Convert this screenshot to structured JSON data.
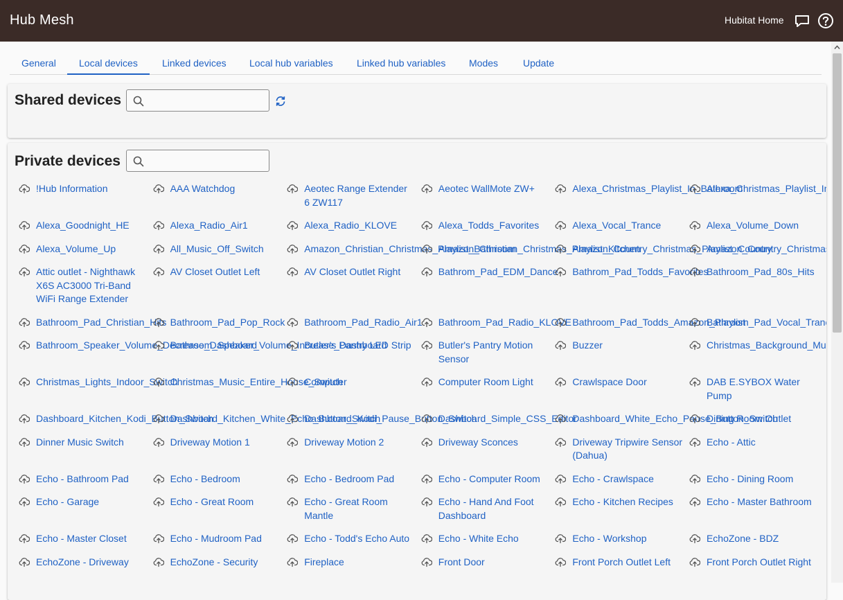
{
  "header": {
    "title": "Hub Mesh",
    "hub_name": "Hubitat Home"
  },
  "tabs": [
    {
      "label": "General",
      "active": false
    },
    {
      "label": "Local devices",
      "active": true
    },
    {
      "label": "Linked devices",
      "active": false
    },
    {
      "label": "Local hub variables",
      "active": false
    },
    {
      "label": "Linked hub variables",
      "active": false
    },
    {
      "label": "Modes",
      "active": false
    },
    {
      "label": "Update",
      "active": false
    }
  ],
  "shared": {
    "title": "Shared devices",
    "search_value": ""
  },
  "private": {
    "title": "Private devices",
    "search_value": "",
    "devices": [
      "!Hub Information",
      "AAA Watchdog",
      "Aeotec Range Extender 6 ZW117",
      "Aeotec WallMote ZW+",
      "Alexa_Christmas_Playlist_In_Bathroom",
      "Alexa_Christmas_Playlist_In_",
      "Alexa_Goodnight_HE",
      "Alexa_Radio_Air1",
      "Alexa_Radio_KLOVE",
      "Alexa_Todds_Favorites",
      "Alexa_Vocal_Trance",
      "Alexa_Volume_Down",
      "Alexa_Volume_Up",
      "All_Music_Off_Switch",
      "Amazon_Christian_Christmas_Playlist_Bathroom",
      "Amazon_Christian_Christmas_Playlist_Kitchen",
      "Amazon_Country_Christmas_Playlist_Country",
      "Amazon_Country_Christmas_",
      "Attic outlet - Nighthawk X6S AC3000 Tri-Band WiFi Range Extender",
      "AV Closet Outlet Left",
      "AV Closet Outlet Right",
      "Bathrom_Pad_EDM_Dance",
      "Bathrom_Pad_Todds_Favorites",
      "Bathroom_Pad_80s_Hits",
      "Bathroom_Pad_Christian_Hits",
      "Bathroom_Pad_Pop_Rock",
      "Bathroom_Pad_Radio_Air1",
      "Bathroom_Pad_Radio_KLOVE",
      "Bathroom_Pad_Todds_Amazon_Playlist",
      "Bathroom_Pad_Vocal_Trance",
      "Bathroom_Speaker_Volume_Decrease_Dashboard",
      "Bathroom_Speaker_Volume_Increase_Dashboard",
      "Butler's Pantry LED Strip",
      "Butler's Pantry Motion Sensor",
      "Buzzer",
      "Christmas_Background_Music",
      "Christmas_Lights_Indoor_Switch",
      "Christmas_Music_Entire_House_Switch",
      "Computer",
      "Computer Room Light",
      "Crawlspace Door",
      "DAB E.SYBOX Water Pump",
      "Dashboard_Kitchen_Kodi_Button_Switch",
      "Dashboard_Kitchen_White_Echo_Button_Switch",
      "Dashboard_Kodi_Pause_Button_Switch",
      "Dashboard_Simple_CSS_Editor",
      "Dashboard_White_Echo_Pause_Button_Switch",
      "Dining Room Outlet",
      "Dinner Music Switch",
      "Driveway Motion 1",
      "Driveway Motion 2",
      "Driveway Sconces",
      "Driveway Tripwire Sensor (Dahua)",
      "Echo - Attic",
      "Echo - Bathroom Pad",
      "Echo - Bedroom",
      "Echo - Bedroom Pad",
      "Echo - Computer Room",
      "Echo - Crawlspace",
      "Echo - Dining Room",
      "Echo - Garage",
      "Echo - Great Room",
      "Echo - Great Room Mantle",
      "Echo - Hand And Foot Dashboard",
      "Echo - Kitchen Recipes",
      "Echo - Master Bathroom",
      "Echo - Master Closet",
      "Echo - Mudroom Pad",
      "Echo - Todd's Echo Auto",
      "Echo - White Echo",
      "Echo - Workshop",
      "EchoZone - BDZ",
      "EchoZone - Driveway",
      "EchoZone - Security",
      "Fireplace",
      "Front Door",
      "Front Porch Outlet Left",
      "Front Porch Outlet Right"
    ]
  }
}
